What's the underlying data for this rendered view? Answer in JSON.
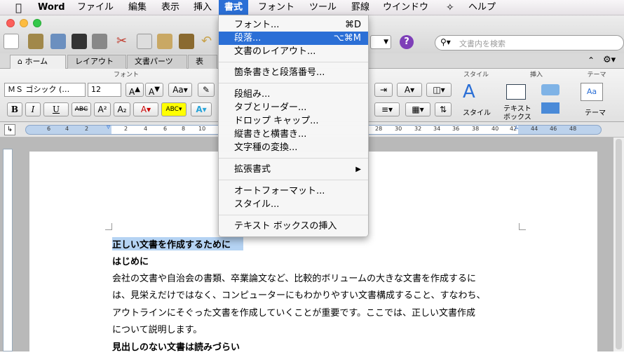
{
  "menubar": {
    "app_name": "Word",
    "items": [
      "ファイル",
      "編集",
      "表示",
      "挿入",
      "書式",
      "フォント",
      "ツール",
      "罫線",
      "ウインドウ",
      "ヘルプ"
    ]
  },
  "toolbar": {
    "search_placeholder": "文書内を検索"
  },
  "ribbon": {
    "tabs": [
      "ホーム",
      "レイアウト",
      "文書パーツ",
      "表"
    ],
    "groups": {
      "font": "フォント",
      "styles": "スタイル",
      "insert": "挿入",
      "theme": "テーマ"
    },
    "font_name": "ＭＳ ゴシック (…",
    "font_size": "12",
    "buttons": {
      "bold": "B",
      "italic": "I",
      "underline": "U",
      "strike": "ABC",
      "superscript": "A²",
      "subscript": "A₂",
      "style_label": "スタイル",
      "textbox_label_1": "テキスト",
      "textbox_label_2": "ボックス",
      "theme_label": "テーマ"
    }
  },
  "ruler": {
    "ticks": [
      "6",
      "4",
      "2",
      "2",
      "4",
      "6",
      "8",
      "10",
      "28",
      "30",
      "32",
      "34",
      "36",
      "38",
      "40",
      "42",
      "44",
      "46",
      "48"
    ]
  },
  "format_menu": {
    "items": [
      {
        "label": "フォント...",
        "shortcut": "⌘D"
      },
      {
        "label": "段落...",
        "shortcut": "⌥⌘M"
      },
      {
        "label": "文書のレイアウト...",
        "shortcut": ""
      },
      {
        "label": "箇条書きと段落番号...",
        "shortcut": ""
      },
      {
        "label": "段組み...",
        "shortcut": ""
      },
      {
        "label": "タブとリーダー...",
        "shortcut": ""
      },
      {
        "label": "ドロップ キャップ...",
        "shortcut": ""
      },
      {
        "label": "縦書きと横書き...",
        "shortcut": ""
      },
      {
        "label": "文字種の変換...",
        "shortcut": ""
      },
      {
        "label": "拡張書式",
        "shortcut": "▶"
      },
      {
        "label": "オートフォーマット...",
        "shortcut": ""
      },
      {
        "label": "スタイル...",
        "shortcut": ""
      },
      {
        "label": "テキスト ボックスの挿入",
        "shortcut": ""
      }
    ]
  },
  "document": {
    "lines": [
      "正しい文書を作成するために",
      "はじめに",
      "会社の文書や自治会の書類、卒業論文など、比較的ボリュームの大きな文書を作成するに",
      "は、見栄えだけではなく、コンピューターにもわかりやすい文書構成すること、すなわち、",
      "アウトラインにそぐった文書を作成していくことが重要です。ここでは、正しい文書作成",
      "について説明します。",
      "見出しのない文書は読みづらい"
    ]
  },
  "colors": {
    "menu_highlight": "#2b6fd6",
    "selection": "#b5d3f3"
  }
}
